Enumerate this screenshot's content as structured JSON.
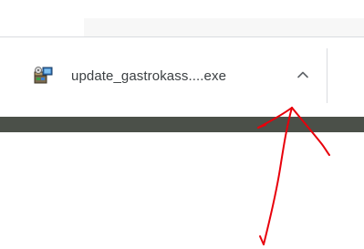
{
  "download_shelf": {
    "file_name": "update_gastrokass....exe",
    "icon": "installer-package-icon",
    "expand_icon": "chevron-up-icon"
  },
  "annotation": {
    "color": "#e8000b",
    "icon": "red-arrow-annotation"
  },
  "colors": {
    "taskbar": "#4b5049",
    "separator": "#dadce0",
    "text": "#3c4043"
  }
}
